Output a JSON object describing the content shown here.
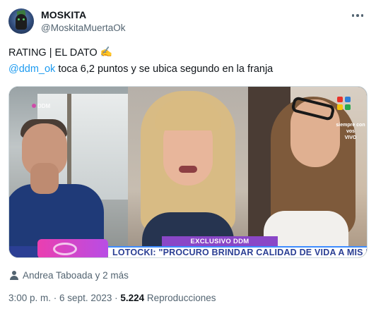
{
  "author": {
    "display_name": "MOSKITA",
    "handle": "@MoskitaMuertaOk",
    "avatar_icon": "avatar-image"
  },
  "more_icon": "more-horizontal-icon",
  "tweet": {
    "line1_text": "RATING | EL DATO",
    "line1_emoji": "✍",
    "mention": "@ddm_ok",
    "line2_rest": " toca 6,2 puntos y se ubica segundo en la franja"
  },
  "media": {
    "overlay_small": "DDM",
    "lower_third_tag": "EXCLUSIVO DDM",
    "lower_third_title": "LOTOCKI: \"PROCURO BRINDAR CALIDAD DE VIDA A MIS PACIENTES\"",
    "live_line1": "siempre con vos",
    "live_line2": "VIVO",
    "brand_colors": [
      "#e8322b",
      "#2f7fd6",
      "#f5c20a",
      "#2aa84f"
    ]
  },
  "tagged": {
    "icon": "person-icon",
    "text": "Andrea Taboada y 2 más"
  },
  "meta": {
    "time": "3:00 p. m.",
    "separator": " · ",
    "date": "6 sept. 2023",
    "separator2": " · ",
    "views_count": "5.224",
    "views_label": " Reproducciones"
  },
  "colors": {
    "link": "#1d9bf0",
    "secondary_text": "#536471",
    "primary_text": "#0f1419"
  }
}
